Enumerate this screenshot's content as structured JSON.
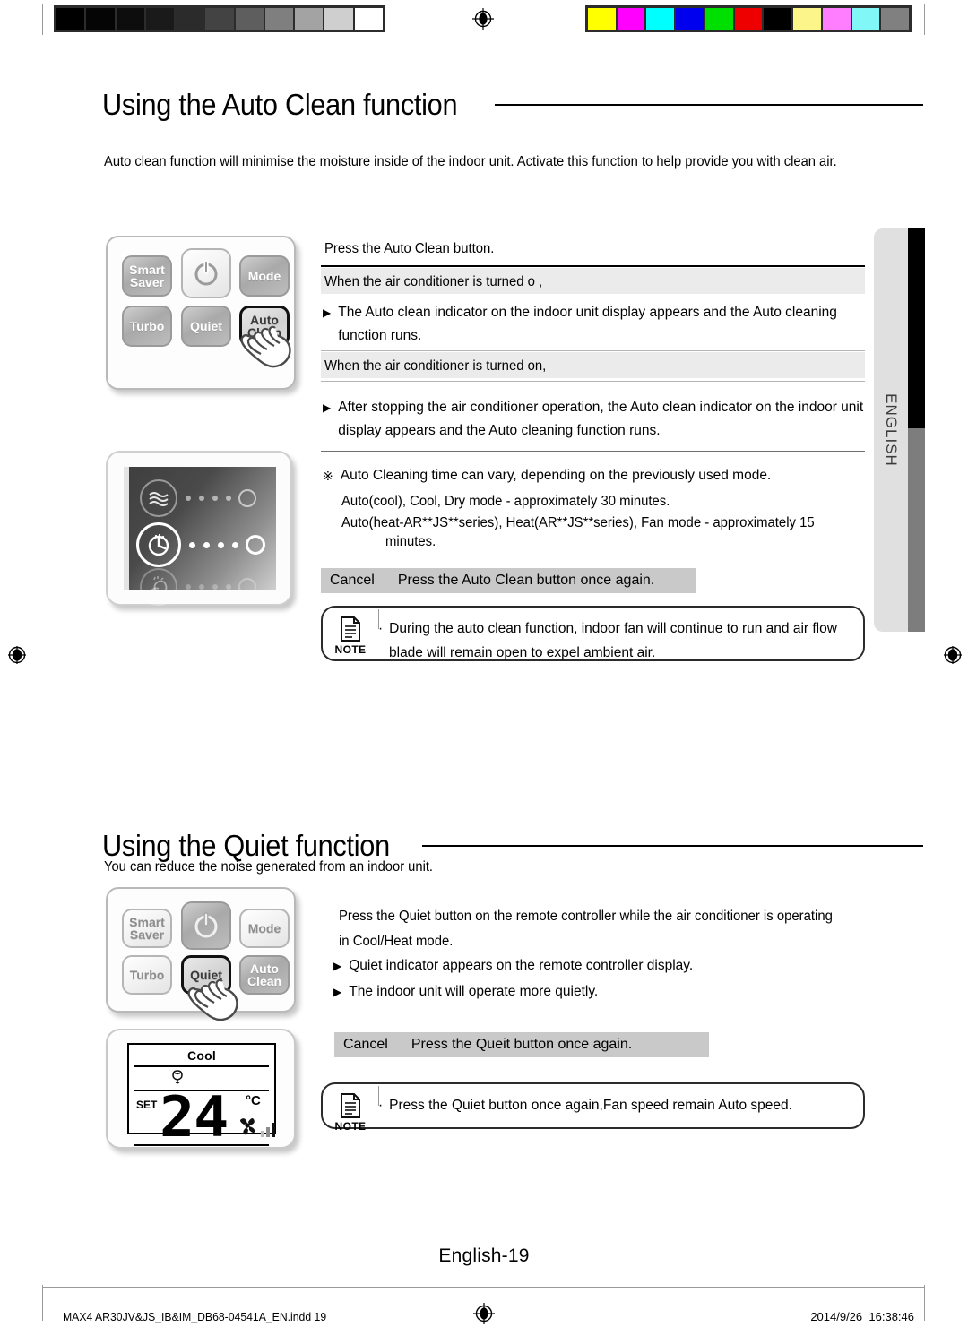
{
  "calibration": {
    "grayscale_steps": [
      "#000000",
      "#050505",
      "#0d0d0d",
      "#1a1a1a",
      "#2b2b2b",
      "#434343",
      "#5e5e5e",
      "#7f7f7f",
      "#a3a3a3",
      "#cfcfcf",
      "#ffffff"
    ],
    "color_swatches": [
      "#ffff00",
      "#ff00ff",
      "#00ffff",
      "#0000ee",
      "#00e000",
      "#ee0000",
      "#000000",
      "#fbf58a",
      "#ff7dff",
      "#82f7f7",
      "#808080"
    ],
    "registration_mark": "registration-target-icon"
  },
  "side_tab": {
    "label": "ENGLISH"
  },
  "sections": [
    {
      "id": "auto-clean",
      "heading": "Using the Auto Clean function",
      "intro": "Auto clean function will minimise the moisture inside of the indoor unit. Activate this function to help provide you with clean air.",
      "remote": {
        "buttons": [
          {
            "label": "Smart\nSaver",
            "name": "smart-saver",
            "state": "normal"
          },
          {
            "label": "",
            "name": "power",
            "state": "light",
            "icon": "power-icon"
          },
          {
            "label": "Mode",
            "name": "mode",
            "state": "normal"
          },
          {
            "label": "Turbo",
            "name": "turbo",
            "state": "normal"
          },
          {
            "label": "Quiet",
            "name": "quiet",
            "state": "normal"
          },
          {
            "label": "Auto\nClean",
            "name": "auto-clean",
            "state": "active"
          }
        ],
        "pointer": "hand-pointer-icon",
        "pointer_target": "auto-clean"
      },
      "display_panel": {
        "rows": [
          {
            "icon": "airflow-waves-icon",
            "state": "normal"
          },
          {
            "icon": "timer-clock-icon",
            "state": "on"
          },
          {
            "icon": "auto-clean-indicator-icon",
            "state": "dim"
          }
        ]
      },
      "step_lead": "Press the Auto Clean button.",
      "case_off_title": "When the air conditioner is turned o ,",
      "case_off_bullet": "The Auto clean indicator on the indoor unit display appears and the Auto cleaning function runs.",
      "case_on_title": "When the air conditioner is turned on,",
      "case_on_bullet": "After stopping the air conditioner operation, the Auto clean indicator on the indoor unit display appears and the Auto cleaning function runs.",
      "note_mark": "※",
      "note_mark_text": "Auto Cleaning time can vary, depending on the previously used mode.",
      "timing_line_1": "Auto(cool), Cool, Dry mode - approximately 30 minutes.",
      "timing_line_2": "Auto(heat-AR**JS**series), Heat(AR**JS**series), Fan mode - approximately 15",
      "timing_line_3": "minutes.",
      "cancel_label": "Cancel",
      "cancel_text": "Press the Auto Clean button once again.",
      "note": {
        "label": "NOTE",
        "icon": "note-document-icon",
        "line1": "During the auto clean function, indoor fan will continue to run and air flow",
        "line2": "blade will remain open to expel ambient air."
      }
    },
    {
      "id": "quiet",
      "heading": "Using the Quiet function",
      "intro": "You can reduce the noise generated from an indoor unit.",
      "remote": {
        "buttons": [
          {
            "label": "Smart\nSaver",
            "name": "smart-saver",
            "state": "light"
          },
          {
            "label": "",
            "name": "power",
            "state": "normal",
            "icon": "power-icon"
          },
          {
            "label": "Mode",
            "name": "mode",
            "state": "light"
          },
          {
            "label": "Turbo",
            "name": "turbo",
            "state": "light"
          },
          {
            "label": "Quiet",
            "name": "quiet",
            "state": "active"
          },
          {
            "label": "Auto\nClean",
            "name": "auto-clean",
            "state": "normal"
          }
        ],
        "pointer": "hand-pointer-icon",
        "pointer_target": "quiet"
      },
      "lcd": {
        "mode": "Cool",
        "quiet_icon": "quiet-leaf-icon",
        "set_label": "SET",
        "temperature": "24",
        "unit": "°C",
        "fan_icon": "fan-icon",
        "fan_bars": 3
      },
      "step_line_1": "Press the Quiet button on the remote controller while the air conditioner is operating",
      "step_line_2": "in Cool/Heat mode.",
      "bullet_1": "Quiet indicator appears on the remote controller display.",
      "bullet_2": "The indoor unit will operate more quietly.",
      "cancel_label": "Cancel",
      "cancel_text": "Press the Queit button once again.",
      "note": {
        "label": "NOTE",
        "icon": "note-document-icon",
        "line1": "Press the Quiet button once again,Fan speed remain Auto speed.",
        "line2": ""
      }
    }
  ],
  "page_number": "English-19",
  "footer": {
    "file": "MAX4 AR30JV&JS_IB&IM_DB68-04541A_EN.indd   19",
    "date": "2014/9/26",
    "time": "16:38:46",
    "center_mark": "registration-target-icon"
  }
}
